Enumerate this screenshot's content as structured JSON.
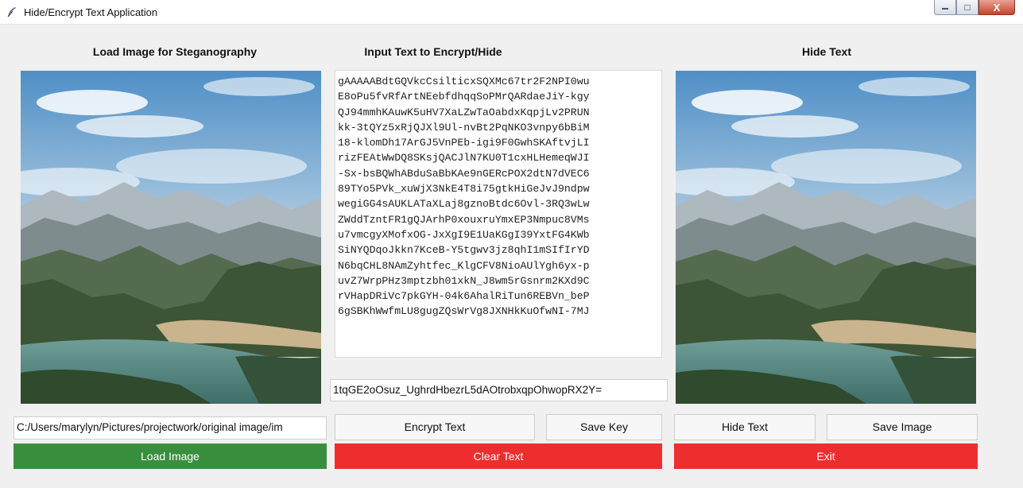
{
  "window": {
    "title": "Hide/Encrypt Text Application",
    "controls": {
      "minimize": "minimize",
      "maximize": "maximize",
      "close": "X"
    }
  },
  "colors": {
    "green": "#3a8f3e",
    "red": "#ee2e2e"
  },
  "left": {
    "heading": "Load Image for Steganography",
    "path_value": "C:/Users/marylyn/Pictures/projectwork/original image/im",
    "load_button": "Load Image"
  },
  "middle": {
    "heading": "Input Text to Encrypt/Hide",
    "text_lines": [
      "gAAAAABdtGQVkcCsilticxSQXMc67tr2F2NPI0wu",
      "E8oPu5fvRfArtNEebfdhqqSoPMrQARdaeJiY-kgy",
      "QJ94mmhKAuwK5uHV7XaLZwTaOabdxKqpjLv2PRUN",
      "kk-3tQYz5xRjQJXl9Ul-nvBt2PqNKO3vnpy6bBiM",
      "18-klomDh17ArGJ5VnPEb-igi9F0GwhSKAftvjLI",
      "rizFEAtWwDQ8SKsjQACJlN7KU0T1cxHLHemeqWJI",
      "-Sx-bsBQWhABduSaBbKAe9nGERcPOX2dtN7dVEC6",
      "89TYo5PVk_xuWjX3NkE4T8i75gtkHiGeJvJ9ndpw",
      "wegiGG4sAUKLATaXLaj8gznoBtdc6Ovl-3RQ3wLw",
      "ZWddTzntFR1gQJArhP0xouxruYmxEP3Nmpuc8VMs",
      "u7vmcgyXMofxOG-JxXgI9E1UaKGgI39YxtFG4KWb",
      "SiNYQDqoJkkn7KceB-Y5tgwv3jz8qhI1mSIfIrYD",
      "N6bqCHL8NAmZyhtfec_KlgCFV8NioAUlYgh6yx-p",
      "uvZ7WrpPHz3mptzbh01xkN_J8wm5rGsnrm2KXd9C",
      "rVHapDRiVc7pkGYH-04k6AhalRiTun6REBVn_beP",
      "6gSBKhWwfmLU8gugZQsWrVg8JXNHkKuOfwNI-7MJ"
    ],
    "key_value": "1tqGE2oOsuz_UghrdHbezrL5dAOtrobxqpOhwopRX2Y=",
    "encrypt_button": "Encrypt Text",
    "save_key_button": "Save Key",
    "clear_button": "Clear Text"
  },
  "right": {
    "heading": "Hide Text",
    "hide_button": "Hide Text",
    "save_image_button": "Save Image",
    "exit_button": "Exit"
  },
  "icons": {
    "app": "feather-icon",
    "images": "landscape-image"
  }
}
